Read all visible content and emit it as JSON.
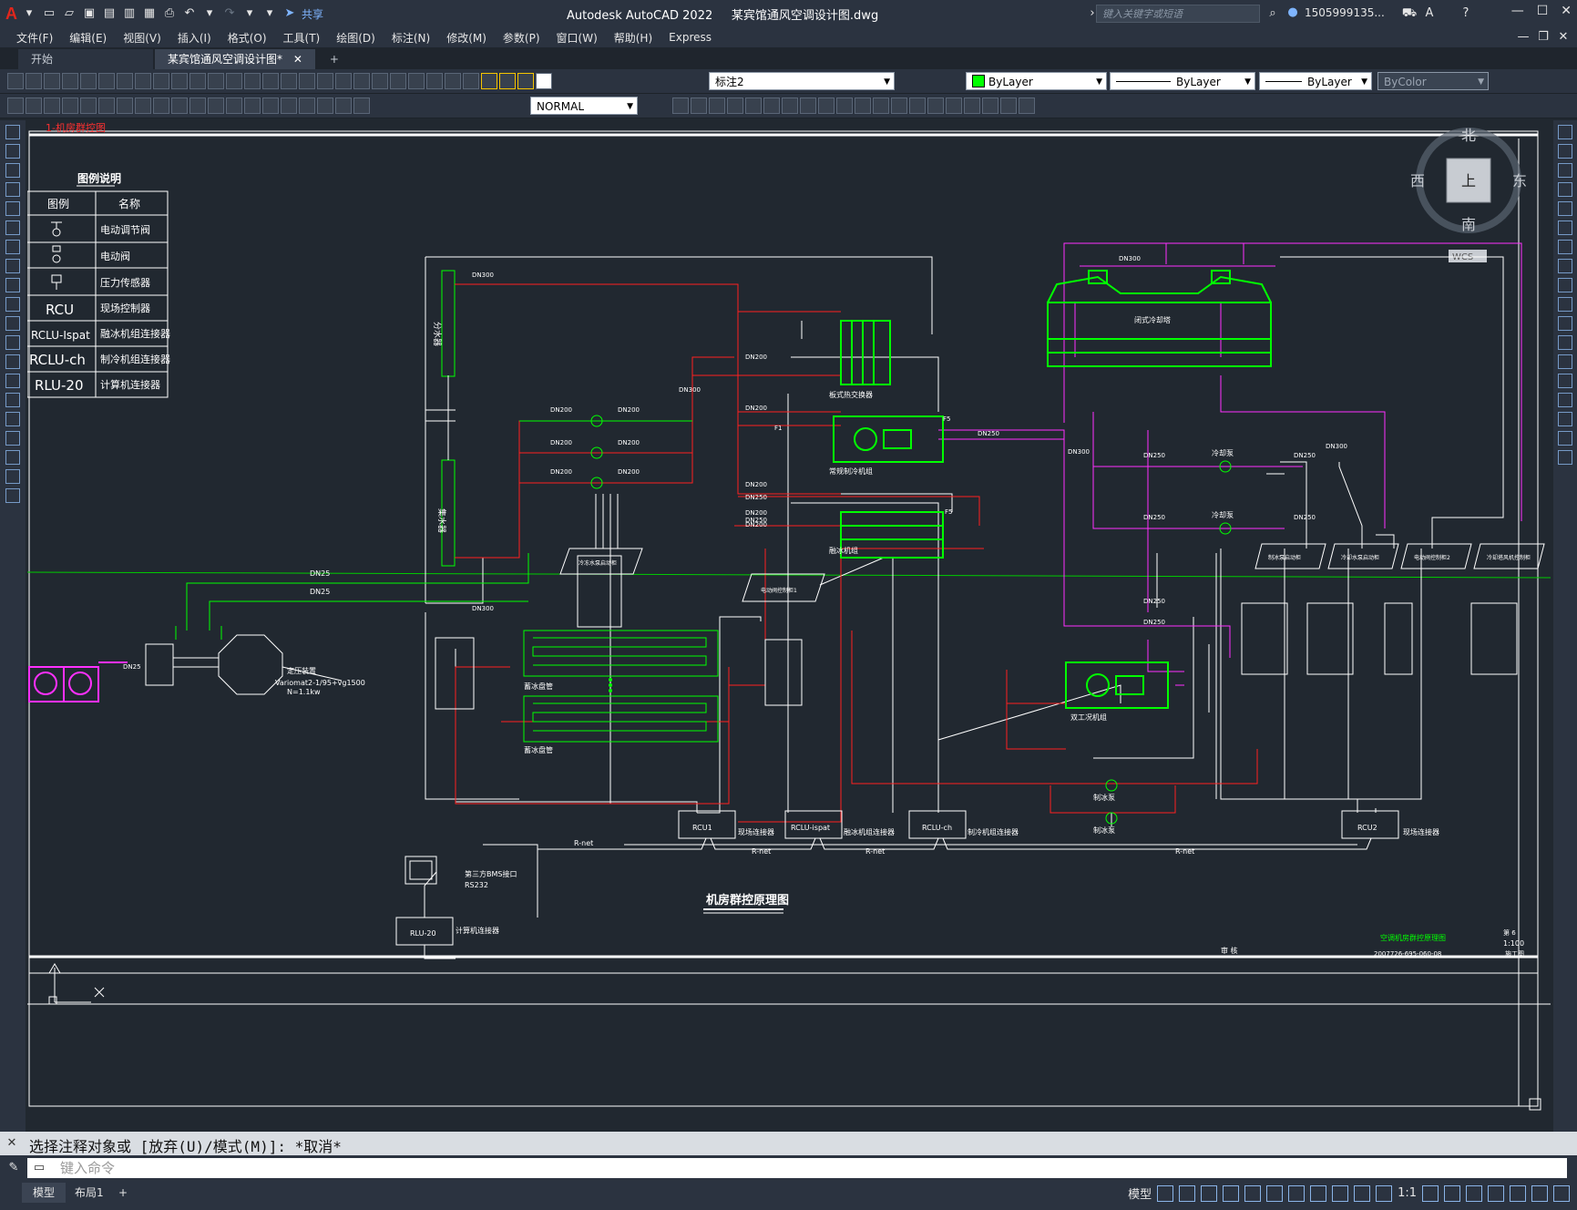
{
  "app": {
    "title": "Autodesk AutoCAD 2022",
    "filename": "某宾馆通风空调设计图.dwg",
    "share_label": "共享",
    "search_placeholder": "键入关键字或短语",
    "user": "1505999135...",
    "logo": "A"
  },
  "menus": [
    "文件(F)",
    "编辑(E)",
    "视图(V)",
    "插入(I)",
    "格式(O)",
    "工具(T)",
    "绘图(D)",
    "标注(N)",
    "修改(M)",
    "参数(P)",
    "窗口(W)",
    "帮助(H)",
    "Express"
  ],
  "tabs": {
    "start": "开始",
    "active": "某宾馆通风空调设计图*",
    "close": "✕",
    "add": "+"
  },
  "toolbar": {
    "layer_value": "标注2",
    "color_value": "ByLayer",
    "linetype_value": "ByLayer",
    "lineweight_value": "ByLayer",
    "plotstyle_value": "ByColor",
    "dimstyle_value": "NORMAL"
  },
  "viewcube": {
    "north": "北",
    "south": "南",
    "east": "东",
    "west": "西",
    "top": "上",
    "wcs": "WCS"
  },
  "drawing": {
    "legend_title": "图例说明",
    "legend_header": [
      "图例",
      "名称"
    ],
    "legend_rows": [
      {
        "symbol": "",
        "name": "电动调节阀"
      },
      {
        "symbol": "",
        "name": "电动阀"
      },
      {
        "symbol": "",
        "name": "压力传感器"
      },
      {
        "symbol": "RCU",
        "name": "现场控制器"
      },
      {
        "symbol": "RCLU-Ispat",
        "name": "融冰机组连接器"
      },
      {
        "symbol": "RCLU-ch",
        "name": "制冷机组连接器"
      },
      {
        "symbol": "RLU-20",
        "name": "计算机连接器"
      }
    ],
    "top_left_label": "1-机房群控图",
    "labels": {
      "supply_header": "分水器",
      "return_header": "集水器",
      "plate_hx": "板式热交换器",
      "chiller": "常规制冷机组",
      "ice_unit": "融冰机组",
      "dual_chiller": "双工况机组",
      "cooling_tower": "闭式冷却塔",
      "cooling_pump1": "冷却泵",
      "cooling_pump2": "冷却泵",
      "ice_pump1": "制冰泵",
      "ice_pump2": "制冰泵",
      "ice_coil1": "蓄冰盘管",
      "ice_coil2": "蓄冰盘管",
      "pressurizer": "定压装置",
      "pressurizer_model": "Variomat2-1/95+vg1500",
      "pressurizer_power": "N=1.1kw",
      "chw_pump_panel": "冷冻水泵启动柜",
      "valve_panel1": "电动阀控制柜1",
      "valve_panel2": "电动阀控制柜2",
      "ice_pump_panel": "制冰泵启动柜",
      "cw_pump_panel": "冷却水泵启动柜",
      "tower_fan_panel": "冷却塔风机控制柜",
      "rcu1": "RCU1",
      "rcu1_desc": "现场连接器",
      "rclu_ispat": "RCLU-ispat",
      "rclu_ispat_desc": "融冰机组连接器",
      "rclu_ch": "RCLU-ch",
      "rclu_ch_desc": "制冷机组连接器",
      "rcu2": "RCU2",
      "rcu2_desc": "现场连接器",
      "rlu20": "RLU-20",
      "rlu20_desc": "计算机连接器",
      "bms": "第三方BMS接口",
      "rs232": "RS232",
      "rnet": "R-net",
      "main_title": "机房群控原理图",
      "tb_project": "空调机房群控原理图",
      "tb_drawno": "2007726-695-060-08",
      "tb_scale": "1:100",
      "tb_sheet": "施工图",
      "tb_rev": "第 6",
      "tb_unit": "审 核"
    },
    "pipe_sizes": {
      "dn300": "DN300",
      "dn200": "DN200",
      "dn250": "DN250",
      "dn25": "DN25",
      "f5": "F5",
      "f1": "F1"
    }
  },
  "command": {
    "history": "选择注释对象或 [放弃(U)/模式(M)]: *取消*",
    "placeholder": "键入命令"
  },
  "status": {
    "model_tab": "模型",
    "layout_tab": "布局1",
    "add": "+",
    "model_label": "模型",
    "scale": "1:1"
  }
}
